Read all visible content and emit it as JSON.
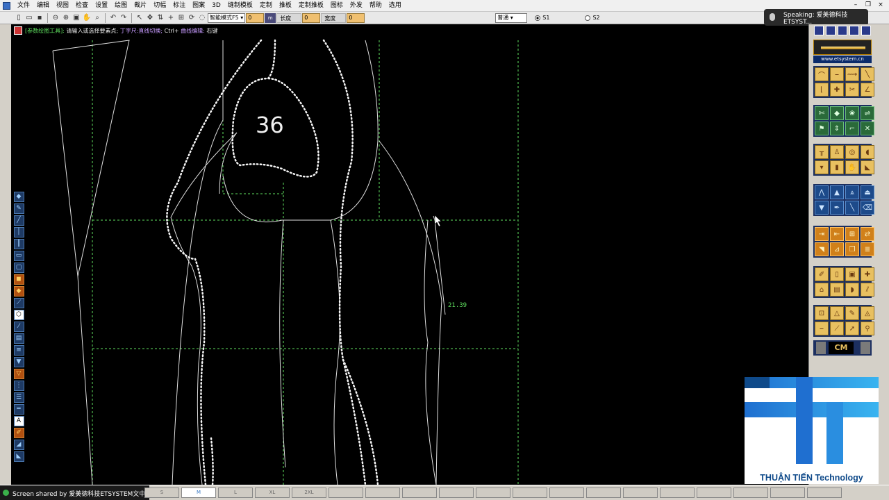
{
  "menu": {
    "items": [
      "文件",
      "编辑",
      "视图",
      "检查",
      "设置",
      "绘图",
      "裁片",
      "切幅",
      "标注",
      "图案",
      "3D",
      "缝制模板",
      "定制",
      "推板",
      "定制推板",
      "图标",
      "外发",
      "帮助",
      "选用"
    ]
  },
  "toolbar": {
    "mode_select": "智能模式F5",
    "field_a": "0",
    "length_label": "长度",
    "length_value": "0",
    "width_label": "宽度",
    "width_value": "0",
    "line_select": "普通",
    "radio_s1": "S1",
    "radio_s2": "S2"
  },
  "hint": {
    "tool": "[参数绘图工具]:",
    "text1": "请输入或选择要素点;",
    "text2": "丁字尺:直线切换;",
    "text3": "Ctrl+",
    "text4": "曲线编辑:",
    "text5": "右键"
  },
  "speaking": {
    "text": "Speaking: 爱美德科技ETSYST..."
  },
  "canvas": {
    "size_label": "36",
    "measurement": "21.39"
  },
  "right_panel": {
    "url": "www.etsystem.cn",
    "unit": "CM"
  },
  "logo": {
    "caption": "THUẬN TIẾN Technology"
  },
  "status": {
    "screen_share": "Screen shared by 爱美德科技ETSYSTEM文中",
    "cells": [
      "S",
      "M",
      "L",
      "XL",
      "2XL",
      "",
      "",
      "",
      "",
      "",
      "",
      "",
      "",
      "",
      "",
      "",
      "",
      "",
      "",
      ""
    ]
  },
  "colors": {
    "canvas_bg": "#000000",
    "pattern_line": "#e0e0e0",
    "guide_line": "#5fe05f",
    "logo_blue": "#0f4a8a"
  }
}
